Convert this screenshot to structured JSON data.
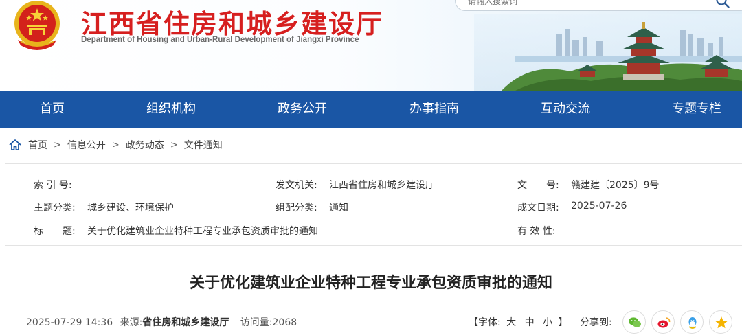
{
  "header": {
    "title": "江西省住房和城乡建设厅",
    "subtitle": "Department of Housing and Urban-Rural Development of Jiangxi Province",
    "search_placeholder": "请输入搜索词"
  },
  "nav": {
    "items": [
      {
        "label": "首页"
      },
      {
        "label": "组织机构"
      },
      {
        "label": "政务公开"
      },
      {
        "label": "办事指南"
      },
      {
        "label": "互动交流"
      },
      {
        "label": "专题专栏"
      }
    ]
  },
  "breadcrumb": {
    "items": [
      "首页",
      "信息公开",
      "政务动态",
      "文件通知"
    ],
    "separator": ">"
  },
  "meta": {
    "index_label": "索 引 号:",
    "index_value": "",
    "issuer_label": "发文机关:",
    "issuer_value": "江西省住房和城乡建设厅",
    "docno_label": "文　　号:",
    "docno_value": "赣建建〔2025〕9号",
    "topic_label": "主题分类:",
    "topic_value": "城乡建设、环境保护",
    "category_label": "组配分类:",
    "category_value": "通知",
    "date_label": "成文日期:",
    "date_value": "2025-07-26",
    "title_label": "标　　题:",
    "title_value": "关于优化建筑业企业特种工程专业承包资质审批的通知",
    "validity_label": "有 效 性:",
    "validity_value": ""
  },
  "article": {
    "title": "关于优化建筑业企业特种工程专业承包资质审批的通知",
    "datetime": "2025-07-29 14:36",
    "source_label": "来源:",
    "source_value": "省住房和城乡建设厅",
    "views_label": "访问量:",
    "views_value": "2068"
  },
  "font_size": {
    "open": "【字体:",
    "large": "大",
    "medium": "中",
    "small": "小",
    "close": "】"
  },
  "share": {
    "label": "分享到:",
    "icons": [
      "wechat-icon",
      "weibo-icon",
      "qq-icon",
      "qzone-icon"
    ]
  },
  "colors": {
    "brand_red": "#d61f1f",
    "nav_blue": "#1a56a5",
    "wechat_green": "#5fb832",
    "weibo_red": "#e6162d",
    "qq_blue": "#3aa0e8",
    "qzone_yellow": "#f5b400"
  }
}
